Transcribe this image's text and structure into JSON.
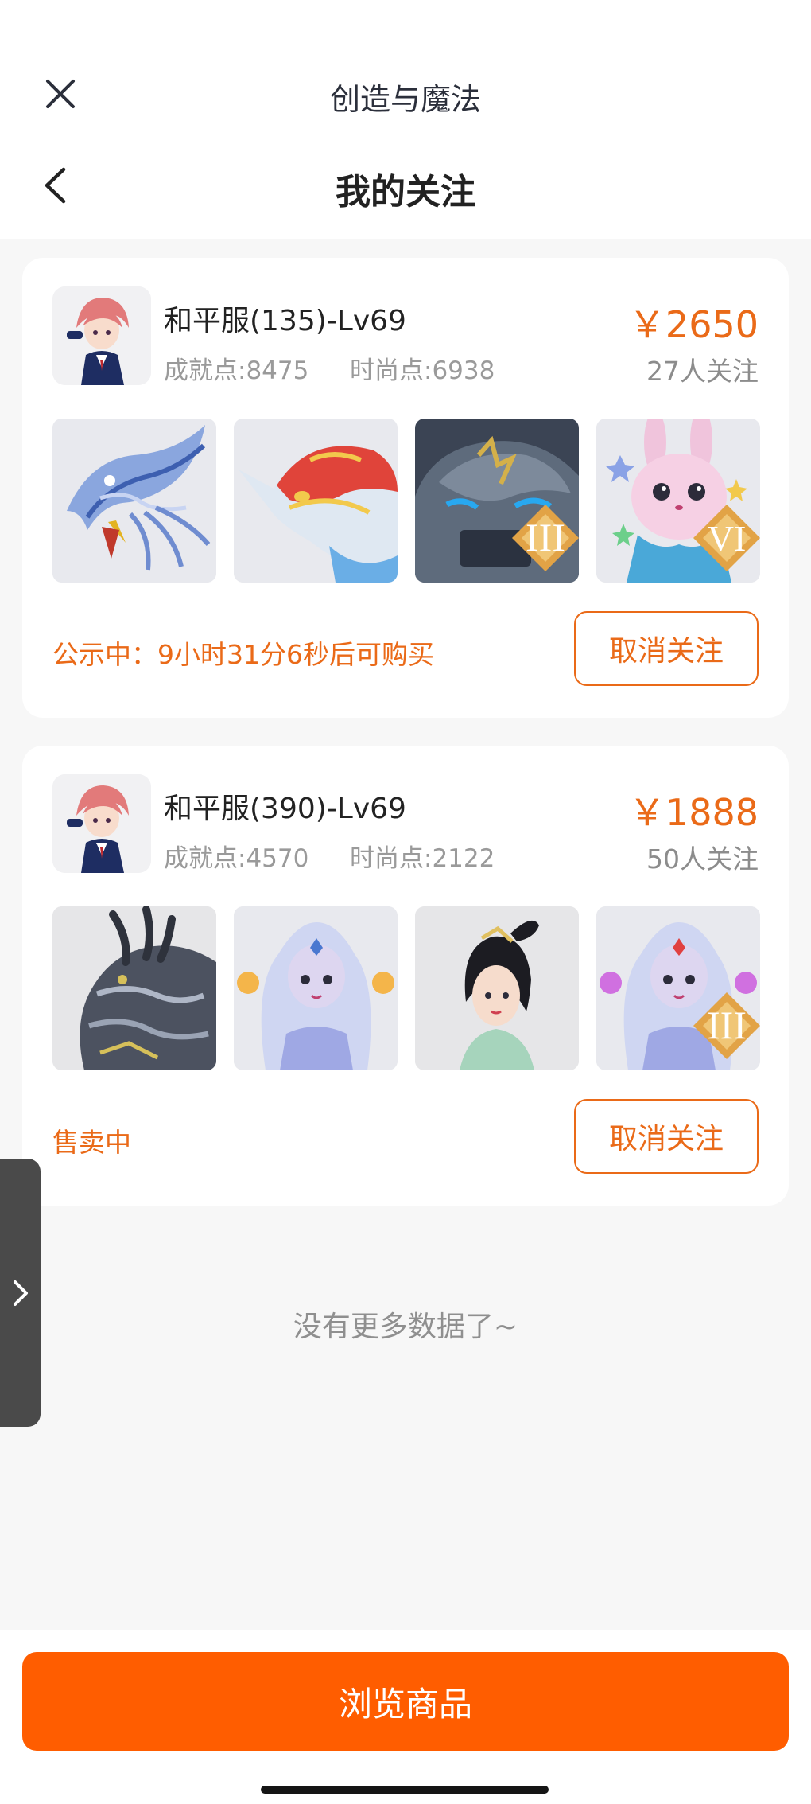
{
  "header": {
    "app_title": "创造与魔法",
    "page_title": "我的关注"
  },
  "listings": [
    {
      "server": "和平服(135)-Lv69",
      "achievement": "成就点:8475",
      "fashion": "时尚点:6938",
      "price": "￥2650",
      "followers": "27人关注",
      "status": "公示中：9小时31分6秒后可购买",
      "unfollow_label": "取消关注",
      "thumbnails": [
        {
          "name": "blue-dragon-mount",
          "badge": ""
        },
        {
          "name": "red-fish-mount",
          "badge": ""
        },
        {
          "name": "stone-golem-mount",
          "badge": "III"
        },
        {
          "name": "pink-bunny-pet",
          "badge": "VI"
        }
      ]
    },
    {
      "server": "和平服(390)-Lv69",
      "achievement": "成就点:4570",
      "fashion": "时尚点:2122",
      "price": "￥1888",
      "followers": "50人关注",
      "status": "售卖中",
      "unfollow_label": "取消关注",
      "thumbnails": [
        {
          "name": "dark-dragon-mount",
          "badge": ""
        },
        {
          "name": "mermaid-pet-orange",
          "badge": ""
        },
        {
          "name": "hanfu-girl-outfit",
          "badge": ""
        },
        {
          "name": "mermaid-pet-pink",
          "badge": "III"
        }
      ]
    }
  ],
  "footer": {
    "no_more": "没有更多数据了~",
    "browse_label": "浏览商品"
  },
  "colors": {
    "accent": "#ea6a18",
    "button": "#ff5d00"
  }
}
